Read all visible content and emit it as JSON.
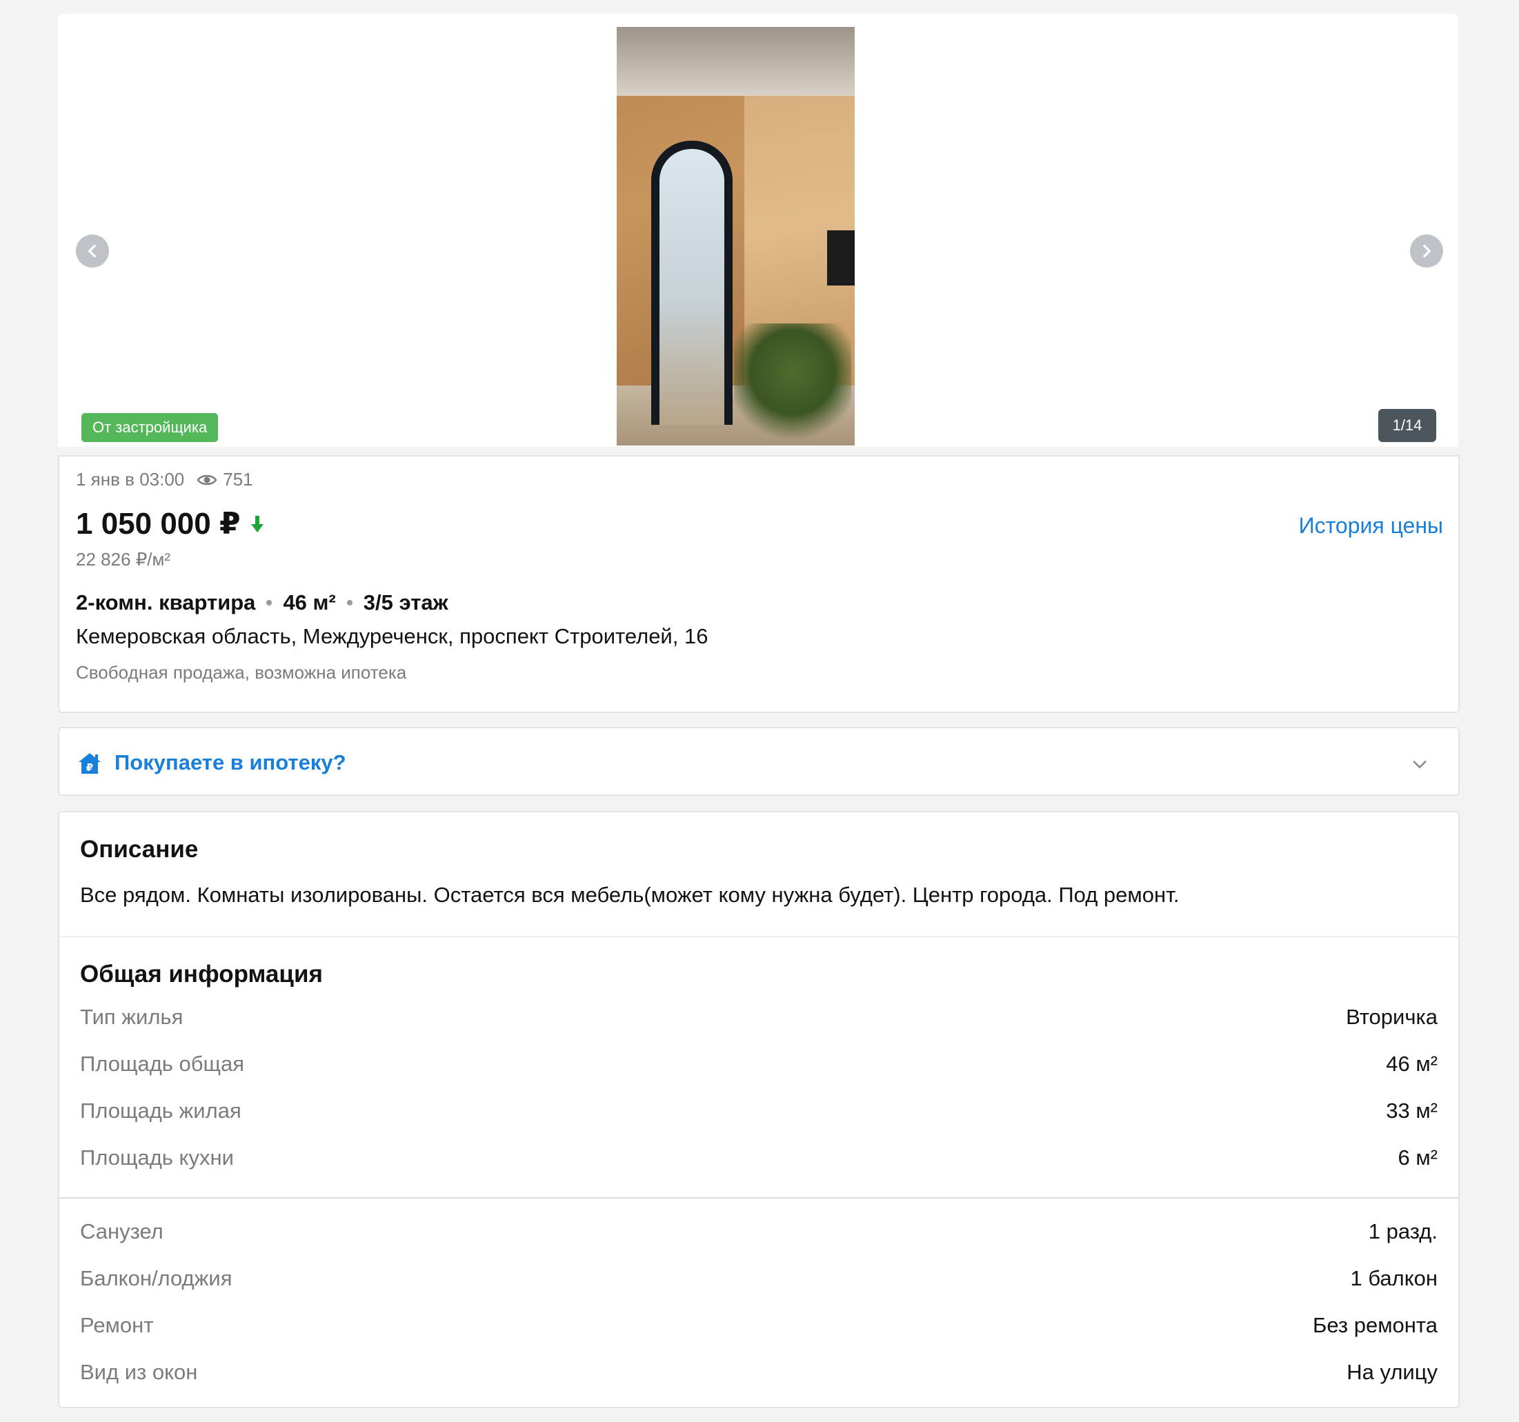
{
  "gallery": {
    "badge": "От застройщика",
    "counter": "1/14",
    "prev_icon": "chevron-left-icon",
    "next_icon": "chevron-right-icon"
  },
  "listing": {
    "date": "1 янв в 03:00",
    "views": "751",
    "price": "1 050 000 ₽",
    "price_trend": "down",
    "price_history_link": "История цены",
    "price_per_m2": "22 826 ₽/м²",
    "rooms": "2-комн. квартира",
    "area": "46 м²",
    "floor": "3/5 этаж",
    "address": "Кемеровская область, Междуреченск, проспект Строителей, 16",
    "terms": "Свободная продажа, возможна ипотека"
  },
  "mortgage": {
    "label": "Покупаете в ипотеку?"
  },
  "description": {
    "title": "Описание",
    "text": "Все рядом. Комнаты изолированы. Остается вся мебель(может кому нужна будет). Центр города. Под ремонт."
  },
  "general_info": {
    "title": "Общая информация",
    "rows": [
      {
        "key": "Тип жилья",
        "value": "Вторичка"
      },
      {
        "key": "Площадь общая",
        "value": "46 м²"
      },
      {
        "key": "Площадь жилая",
        "value": "33 м²"
      },
      {
        "key": "Площадь кухни",
        "value": "6 м²"
      }
    ],
    "rows2": [
      {
        "key": "Санузел",
        "value": "1 разд."
      },
      {
        "key": "Балкон/лоджия",
        "value": "1 балкон"
      },
      {
        "key": "Ремонт",
        "value": "Без ремонта"
      },
      {
        "key": "Вид из окон",
        "value": "На улицу"
      }
    ]
  },
  "colors": {
    "accent": "#1a7fd8",
    "badge_green": "#54b85a",
    "price_down": "#1fa33a",
    "muted_text": "#7b7b7b",
    "background": "#f3f3f3"
  }
}
